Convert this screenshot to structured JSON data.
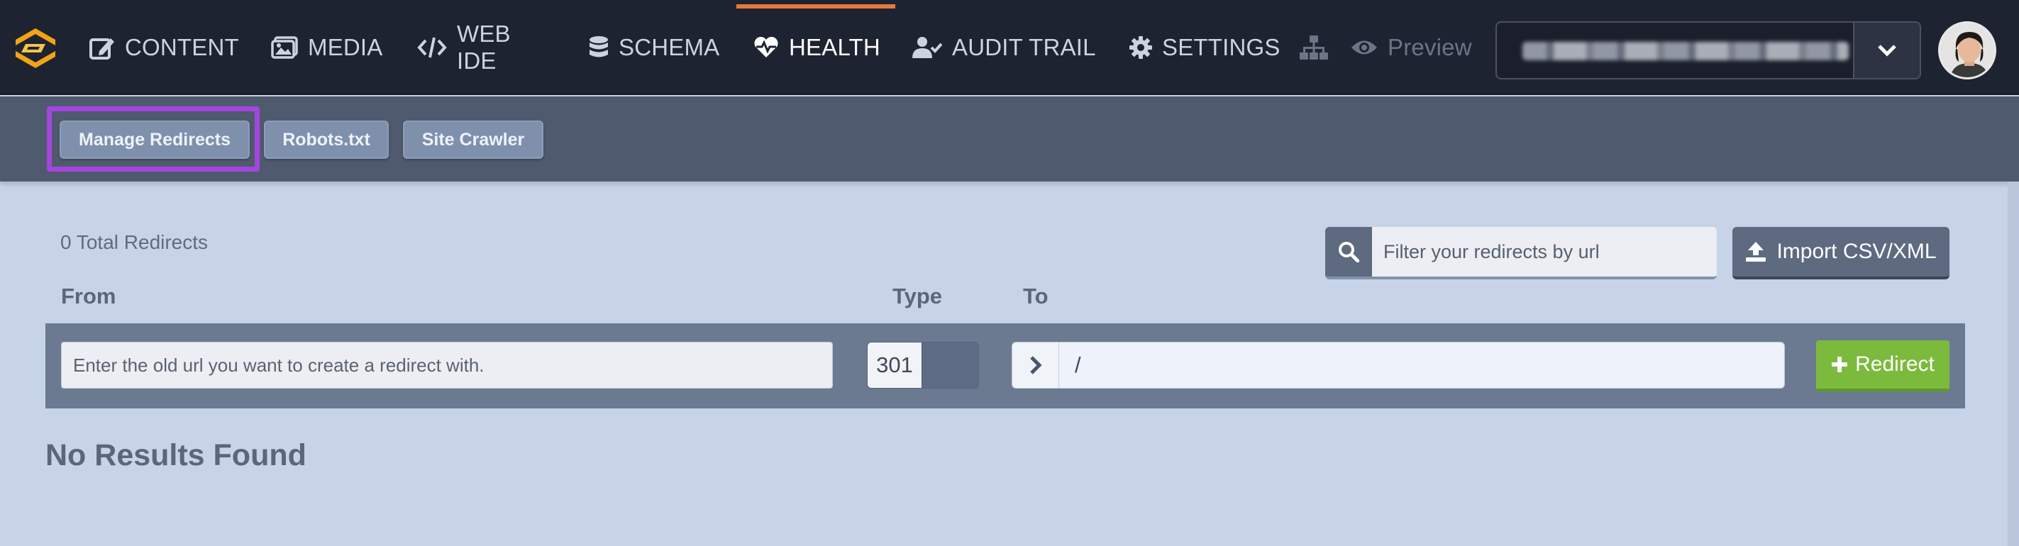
{
  "nav": {
    "items": [
      {
        "id": "content",
        "label": "CONTENT",
        "icon": "edit-icon"
      },
      {
        "id": "media",
        "label": "MEDIA",
        "icon": "images-icon"
      },
      {
        "id": "webide_line1",
        "label": "WEB"
      },
      {
        "id": "webide_line2",
        "label": "IDE",
        "icon": "code-icon"
      },
      {
        "id": "schema",
        "label": "SCHEMA",
        "icon": "database-icon"
      },
      {
        "id": "health",
        "label": "HEALTH",
        "icon": "heartbeat-icon",
        "active": true
      },
      {
        "id": "audit",
        "label": "AUDIT TRAIL",
        "icon": "user-check-icon"
      },
      {
        "id": "settings",
        "label": "SETTINGS",
        "icon": "gear-icon"
      },
      {
        "id": "preview",
        "label": "Preview",
        "icon": "eye-icon"
      }
    ],
    "active_accent": "#e67a3c"
  },
  "subnav": {
    "manage_redirects": "Manage Redirects",
    "robots": "Robots.txt",
    "site_crawler": "Site Crawler",
    "highlight_color": "#a445e0"
  },
  "redirects": {
    "total_label": "0 Total Redirects",
    "filter_placeholder": "Filter your redirects by url",
    "import_label": "Import CSV/XML",
    "col_from": "From",
    "col_type": "Type",
    "col_to": "To",
    "from_placeholder": "Enter the old url you want to create a redirect with.",
    "type_value": "301",
    "to_value": "/",
    "redirect_button": "Redirect",
    "no_results": "No Results Found",
    "button_green": "#7cba3d"
  }
}
